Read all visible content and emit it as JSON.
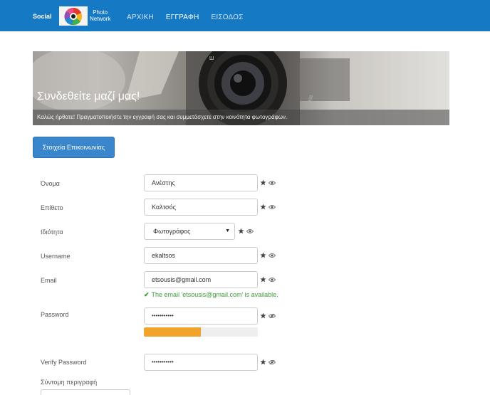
{
  "header": {
    "logo_left": "Social",
    "logo_right_line1": "Photo",
    "logo_right_line2": "Network",
    "nav": [
      {
        "label": "ΑΡΧΙΚΗ",
        "active": false
      },
      {
        "label": "ΕΓΓΡΑΦΗ",
        "active": true
      },
      {
        "label": "ΕΙΣΟΔΟΣ",
        "active": false
      }
    ],
    "bar_color": "#1579c4"
  },
  "banner": {
    "title": "Συνδεθείτε μαζί μας!",
    "subtitle": "Καλώς ήρθατε! Πραγματοποιήστε την εγγραφή σας και συμμετάσχετε στην κοινότητα φωτογράφων."
  },
  "section": {
    "button_label": "Στοιχεία Επικοινωνίας",
    "button_color": "#3a86cc"
  },
  "form": {
    "first_name": {
      "label": "Όνομα",
      "value": "Ανέστης"
    },
    "last_name": {
      "label": "Επίθετο",
      "value": "Καλτσός"
    },
    "role": {
      "label": "Ιδιότητα",
      "value": "Φωτογράφος"
    },
    "username": {
      "label": "Username",
      "value": "ekaltsos"
    },
    "email": {
      "label": "Email",
      "value": "etsousis@gmail.com",
      "status": "The email 'etsousis@gmail.com' is available.",
      "status_color": "#3c9a38"
    },
    "password": {
      "label": "Password",
      "value": "•••••••••••",
      "strength_fraction": 0.5,
      "strength_color": "#f0a42c"
    },
    "verify_password": {
      "label": "Verify Password",
      "value": "•••••••••••"
    },
    "short_description": {
      "label": "Σύντομη περιγραφή"
    }
  },
  "icons": {
    "required": "star-icon",
    "visible": "eye-icon",
    "hidden": "eye-slash-icon"
  }
}
